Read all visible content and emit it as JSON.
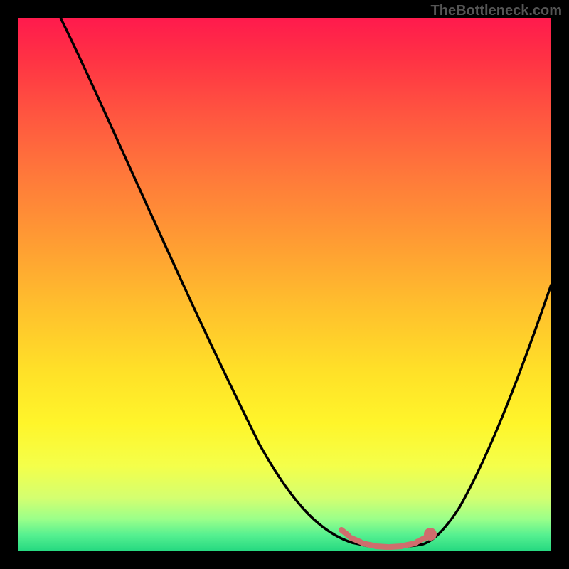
{
  "watermark": "TheBottleneck.com",
  "chart_data": {
    "type": "line",
    "title": "",
    "xlabel": "",
    "ylabel": "",
    "xlim": [
      0,
      100
    ],
    "ylim": [
      0,
      100
    ],
    "grid": false,
    "legend": false,
    "background_gradient": {
      "top": "#ff1a4d",
      "mid": "#fff52a",
      "bottom": "#25d880"
    },
    "series": [
      {
        "name": "bottleneck-curve",
        "color": "#000000",
        "x": [
          8,
          15,
          25,
          35,
          45,
          55,
          60,
          63,
          68,
          73,
          78,
          85,
          92,
          100
        ],
        "y": [
          100,
          88,
          72,
          56,
          40,
          20,
          8,
          2,
          0,
          0,
          2,
          10,
          26,
          50
        ]
      }
    ],
    "markers": [
      {
        "name": "optimal-range",
        "color": "#d46a6a",
        "x": [
          61,
          63,
          65,
          67,
          69,
          71,
          73,
          75,
          77
        ],
        "y": [
          3,
          1.5,
          0.5,
          0,
          0,
          0,
          0.5,
          1.5,
          3
        ]
      }
    ]
  }
}
